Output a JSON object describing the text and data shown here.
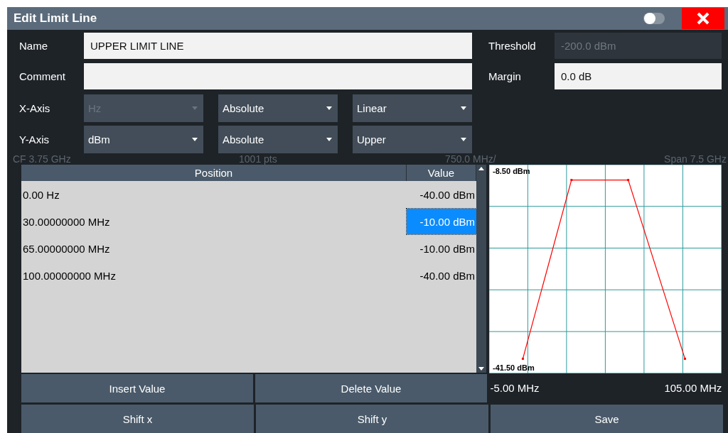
{
  "window": {
    "title": "Edit Limit Line",
    "toggle_on": false
  },
  "form": {
    "name_label": "Name",
    "name_value": "UPPER LIMIT LINE",
    "comment_label": "Comment",
    "threshold_label": "Threshold",
    "threshold_value": "-200.0 dBm",
    "threshold_disabled": true,
    "margin_label": "Margin",
    "margin_value": "0.0 dB"
  },
  "axes": [
    {
      "label": "X-Axis",
      "dropdowns": [
        {
          "value": "Hz",
          "disabled": true
        },
        {
          "value": "Absolute",
          "disabled": false
        },
        {
          "value": "Linear",
          "disabled": false
        }
      ]
    },
    {
      "label": "Y-Axis",
      "dropdowns": [
        {
          "value": "dBm",
          "disabled": false
        },
        {
          "value": "Absolute",
          "disabled": false
        },
        {
          "value": "Upper",
          "disabled": false
        }
      ]
    }
  ],
  "background_status": [
    "CF 3.75 GHz",
    "1001 pts",
    "750.0 MHz/",
    "Span 7.5 GHz"
  ],
  "table": {
    "columns": [
      "Position",
      "Value"
    ],
    "rows": [
      {
        "position": "0.00 Hz",
        "value": "-40.00 dBm",
        "selected": false
      },
      {
        "position": "30.00000000 MHz",
        "value": "-10.00 dBm",
        "selected": true
      },
      {
        "position": "65.00000000 MHz",
        "value": "-10.00 dBm",
        "selected": false
      },
      {
        "position": "100.00000000 MHz",
        "value": "-40.00 dBm",
        "selected": false
      }
    ]
  },
  "preview": {
    "chart_data": {
      "type": "line",
      "x": [
        0,
        30,
        65,
        100
      ],
      "series": [
        {
          "color": "#ff0000",
          "marker": "square",
          "values": [
            -40,
            -10,
            -10,
            -40
          ]
        }
      ],
      "xlim": [
        -20.8,
        122.6
      ],
      "ylim": [
        -42.45,
        -7.43
      ],
      "xticks": [
        {
          "value": -5,
          "label": "-5.00 MHz"
        },
        {
          "value": 105,
          "label": "105.00 MHz"
        }
      ],
      "yticks": [
        {
          "value": -8.5,
          "label": "-8.50 dBm"
        },
        {
          "value": -41.5,
          "label": "-41.50 dBm"
        }
      ]
    }
  },
  "buttons": [
    [
      "Insert Value",
      "Delete Value"
    ],
    [
      "Shift x",
      "Shift y",
      "Save"
    ]
  ]
}
